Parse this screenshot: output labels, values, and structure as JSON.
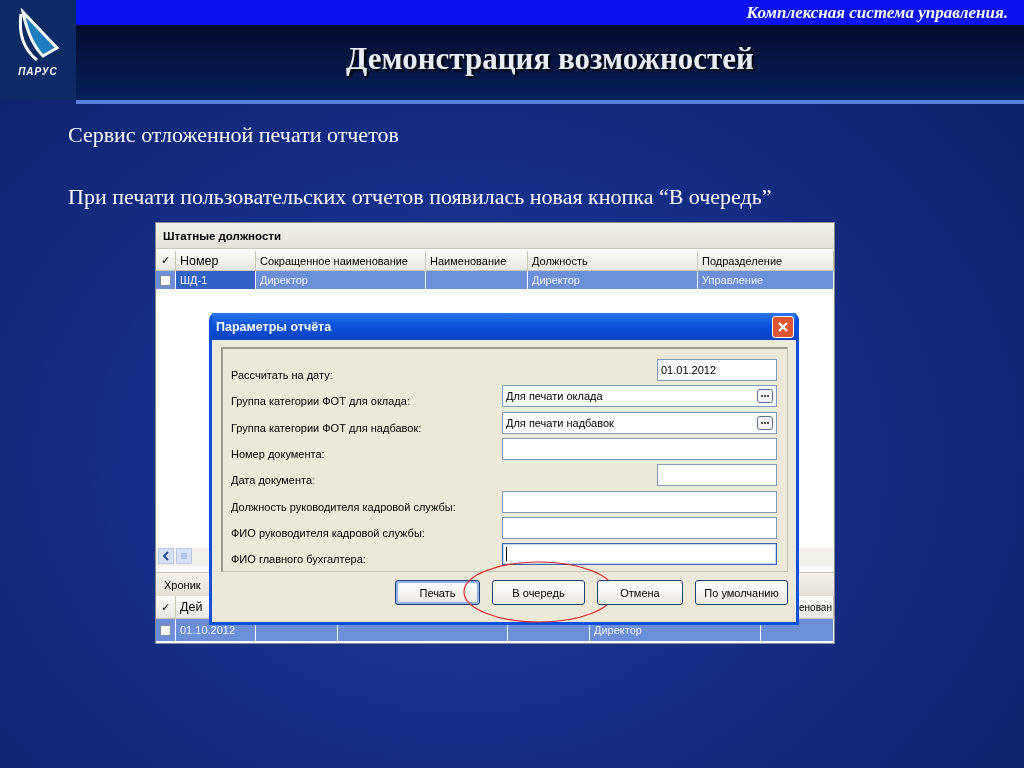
{
  "slide": {
    "logo_text": "ПАРУС",
    "tagline": "Комплексная система управления.",
    "title": "Демонстрация возможностей",
    "lines": [
      "Сервис отложенной печати отчетов",
      "При печати пользовательских отчетов появилась новая кнопка “В очередь”"
    ]
  },
  "app": {
    "title": "Штатные должности",
    "check_header": "✓",
    "columns": [
      "Номер",
      "Сокращенное наименование",
      "Наименование",
      "Должность",
      "Подразделение"
    ],
    "rows": [
      {
        "number": "ШД-1",
        "short_name": "Директор",
        "position": "Директор",
        "department": "Управление",
        "checked": false,
        "selected": true
      }
    ],
    "history_tab": "Хроник",
    "history_check_header": "✓",
    "history_columns": {
      "column_1": "Дей",
      "column_6": "енован"
    },
    "history_rows": [
      {
        "column_1": "01.10.2012",
        "column_5": "Директор",
        "checked": false,
        "selected": true
      }
    ]
  },
  "dialog": {
    "title": "Параметры отчёта",
    "fields": [
      {
        "kind": "date",
        "label": "Рассчитать на дату:",
        "value": "01.01.2012",
        "focused": false
      },
      {
        "kind": "lookup",
        "label": "Группа категории ФОТ для оклада:",
        "value": "Для печати оклада",
        "focused": false
      },
      {
        "kind": "lookup",
        "label": "Группа категории ФОТ для надбавок:",
        "value": "Для печати надбавок",
        "focused": false
      },
      {
        "kind": "text",
        "label": "Номер документа:",
        "focused": false
      },
      {
        "kind": "date",
        "label": "Дата документа:",
        "focused": false
      },
      {
        "kind": "text",
        "label": "Должность руководителя кадровой службы:",
        "focused": false
      },
      {
        "kind": "text",
        "label": "ФИО руководителя кадровой службы:",
        "focused": false
      },
      {
        "kind": "text",
        "label": "ФИО главного бухгалтера:",
        "focused": true
      }
    ],
    "buttons": [
      {
        "label": "Печать",
        "default": true,
        "highlighted": false
      },
      {
        "label": "В очередь",
        "default": false,
        "highlighted": true
      },
      {
        "label": "Отмена",
        "default": false,
        "highlighted": false
      },
      {
        "label": "По умолчанию",
        "default": false,
        "highlighted": false
      }
    ]
  }
}
